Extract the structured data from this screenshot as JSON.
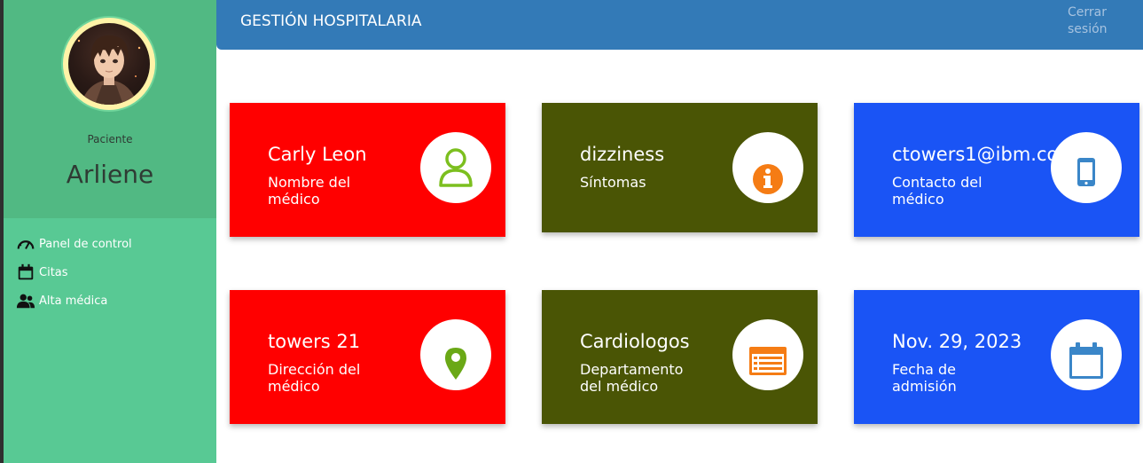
{
  "header": {
    "title": "GESTIÓN HOSPITALARIA",
    "logout_line1": "Cerrar",
    "logout_line2": "sesión"
  },
  "sidebar": {
    "role": "Paciente",
    "user_name": "Arliene",
    "items": [
      {
        "label": "Panel de control",
        "icon": "dashboard-gauge-icon"
      },
      {
        "label": "Citas",
        "icon": "calendar-icon"
      },
      {
        "label": "Alta médica",
        "icon": "users-icon"
      }
    ]
  },
  "cards": [
    {
      "value": "Carly Leon",
      "label_line1": "Nombre del",
      "label_line2": "médico",
      "icon": "user-outline-icon",
      "icon_color": "#7cbf1f",
      "bg": "#ff0000"
    },
    {
      "value": "dizziness",
      "label_line1": "Síntomas",
      "label_line2": "",
      "icon": "info-icon",
      "icon_color": "#f57c14",
      "bg": "#4a5505"
    },
    {
      "value": "ctowers1@ibm.com",
      "label_line1": "Contacto del",
      "label_line2": "médico",
      "icon": "mobile-phone-icon",
      "icon_color": "#3a86c8",
      "bg": "#1a54f5"
    },
    {
      "value": "towers 21",
      "label_line1": "Dirección del",
      "label_line2": "médico",
      "icon": "map-marker-icon",
      "icon_color": "#6aa816",
      "bg": "#ff0000"
    },
    {
      "value": "Cardiologos",
      "label_line1": "Departamento",
      "label_line2": "del médico",
      "icon": "list-card-icon",
      "icon_color": "#f57c14",
      "bg": "#4a5505"
    },
    {
      "value": "Nov. 29, 2023",
      "label_line1": "Fecha de",
      "label_line2": "admisión",
      "icon": "calendar-icon",
      "icon_color": "#3a86c8",
      "bg": "#1a54f5"
    }
  ]
}
